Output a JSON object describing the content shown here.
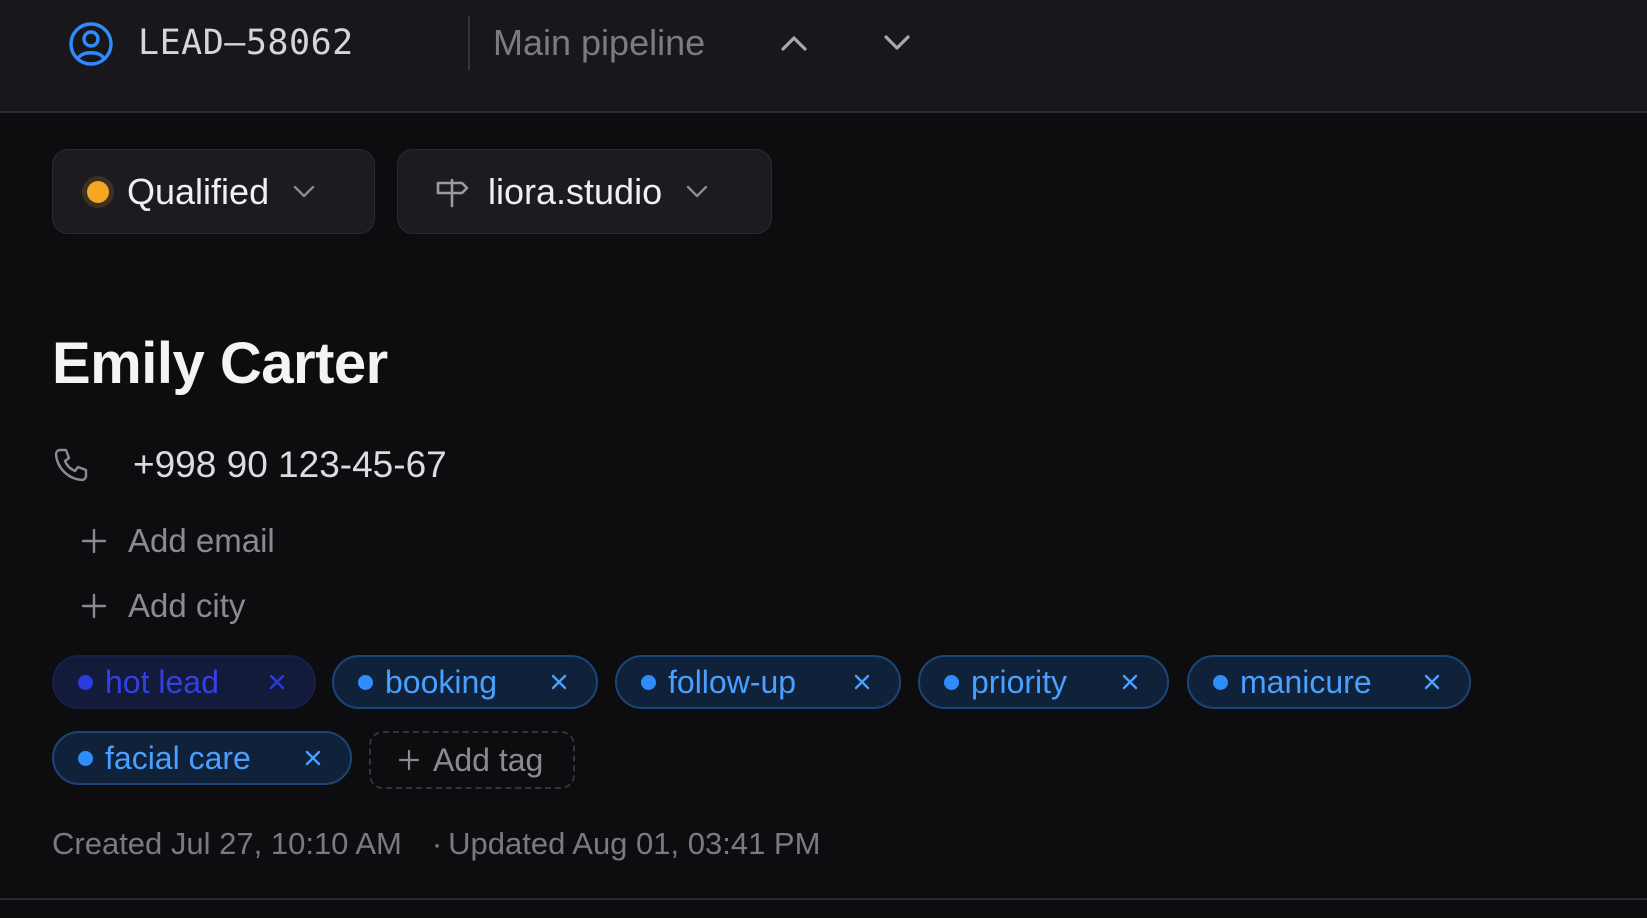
{
  "header": {
    "lead_id": "LEAD–58062",
    "pipeline": "Main pipeline",
    "icons": {
      "lead": "user-circle-icon",
      "prev": "chevron-up-icon",
      "next": "chevron-down-icon"
    }
  },
  "status": {
    "label": "Qualified",
    "color": "#f5a623"
  },
  "source": {
    "label": "liora.studio",
    "icon": "signpost-icon"
  },
  "contact": {
    "name": "Emily Carter",
    "phone": "+998 90 123-45-67",
    "add_email": "Add email",
    "add_city": "Add city"
  },
  "tags": [
    {
      "label": "hot lead"
    },
    {
      "label": "booking"
    },
    {
      "label": "follow-up"
    },
    {
      "label": "priority"
    },
    {
      "label": "manicure"
    },
    {
      "label": "facial care"
    }
  ],
  "add_tag": "Add tag",
  "meta": {
    "created": "Created Jul 27, 10:10 AM",
    "separator": "·",
    "updated": "Updated Aug 01, 03:41 PM"
  },
  "colors": {
    "accent": "#2f8cff",
    "tag_text": "#4aa0ff",
    "background": "#0d0d10"
  }
}
